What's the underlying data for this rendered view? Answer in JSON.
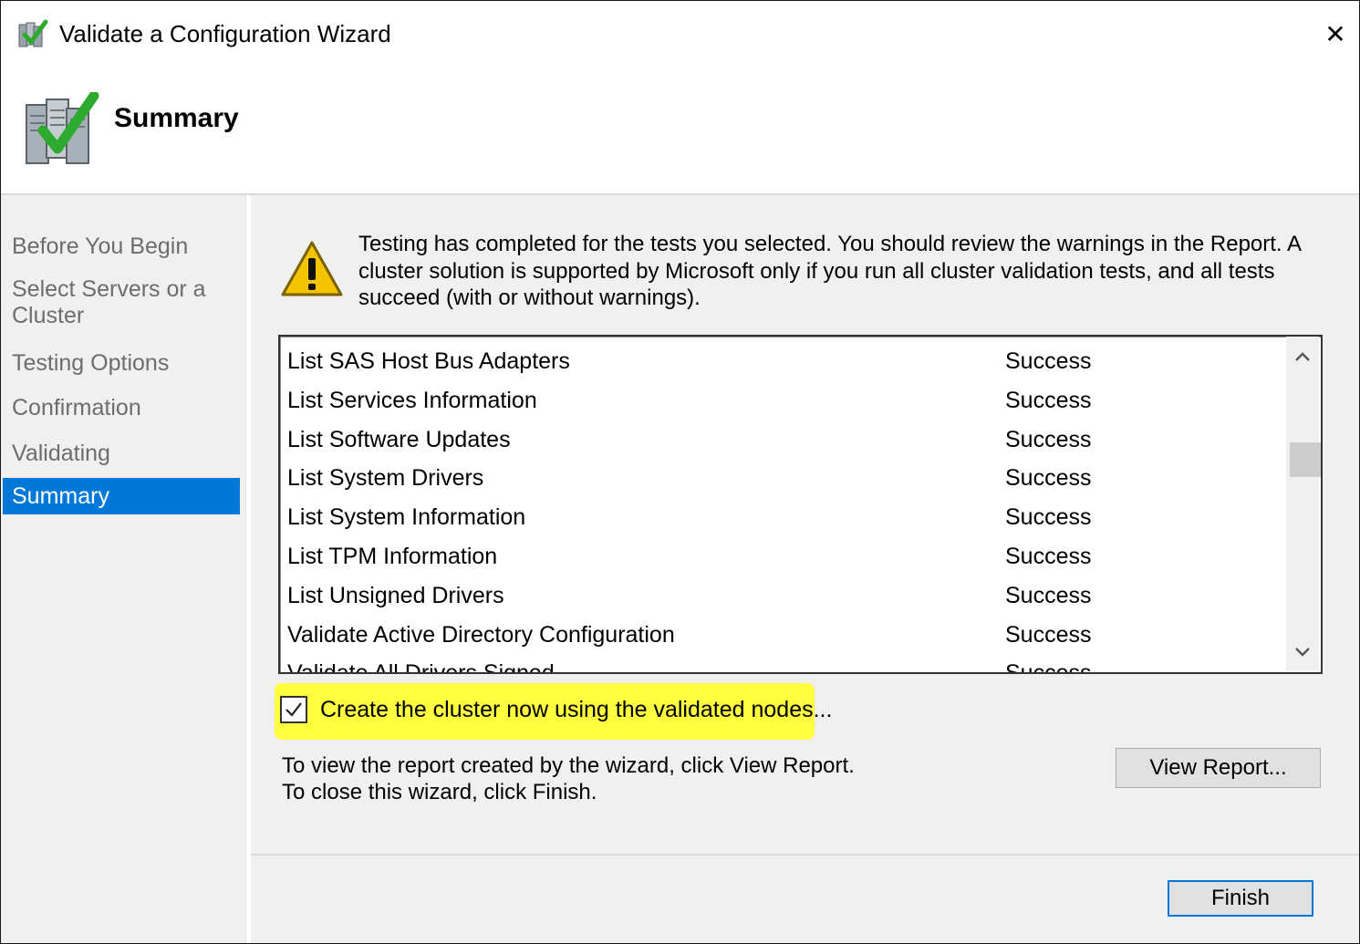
{
  "window": {
    "title": "Validate a Configuration Wizard",
    "close_glyph": "✕"
  },
  "header": {
    "title": "Summary"
  },
  "nav": {
    "items": [
      {
        "label": "Before You Begin"
      },
      {
        "label": "Select Servers or a"
      },
      {
        "label": "Cluster"
      },
      {
        "label": "Testing Options"
      },
      {
        "label": "Confirmation"
      },
      {
        "label": "Validating"
      },
      {
        "label": "Summary"
      }
    ],
    "selected": "Summary"
  },
  "message": {
    "text": "Testing has completed for the tests you selected. You should review the warnings in the Report.  A cluster solution is supported by Microsoft only if you run all cluster validation tests, and all tests succeed (with or without warnings)."
  },
  "results": {
    "rows": [
      {
        "name": "List SAS Host Bus Adapters",
        "status": "Success"
      },
      {
        "name": "List Services Information",
        "status": "Success"
      },
      {
        "name": "List Software Updates",
        "status": "Success"
      },
      {
        "name": "List System Drivers",
        "status": "Success"
      },
      {
        "name": "List System Information",
        "status": "Success"
      },
      {
        "name": "List TPM Information",
        "status": "Success"
      },
      {
        "name": "List Unsigned Drivers",
        "status": "Success"
      },
      {
        "name": "Validate Active Directory Configuration",
        "status": "Success"
      },
      {
        "name": "Validate All Drivers Signed",
        "status": "Success"
      }
    ]
  },
  "create_cluster": {
    "label": "Create the cluster now using the validated nodes...",
    "checked": true
  },
  "info": {
    "line1": "To view the report created by the wizard, click View Report.",
    "line2": "To close this wizard, click Finish."
  },
  "buttons": {
    "view_report": "View Report...",
    "finish": "Finish"
  },
  "colors": {
    "accent": "#0078d7",
    "highlight": "#ffff40",
    "nav_text": "#6d6d6d",
    "check_green": "#2eaa2e",
    "warning_yellow": "#f5c400"
  }
}
